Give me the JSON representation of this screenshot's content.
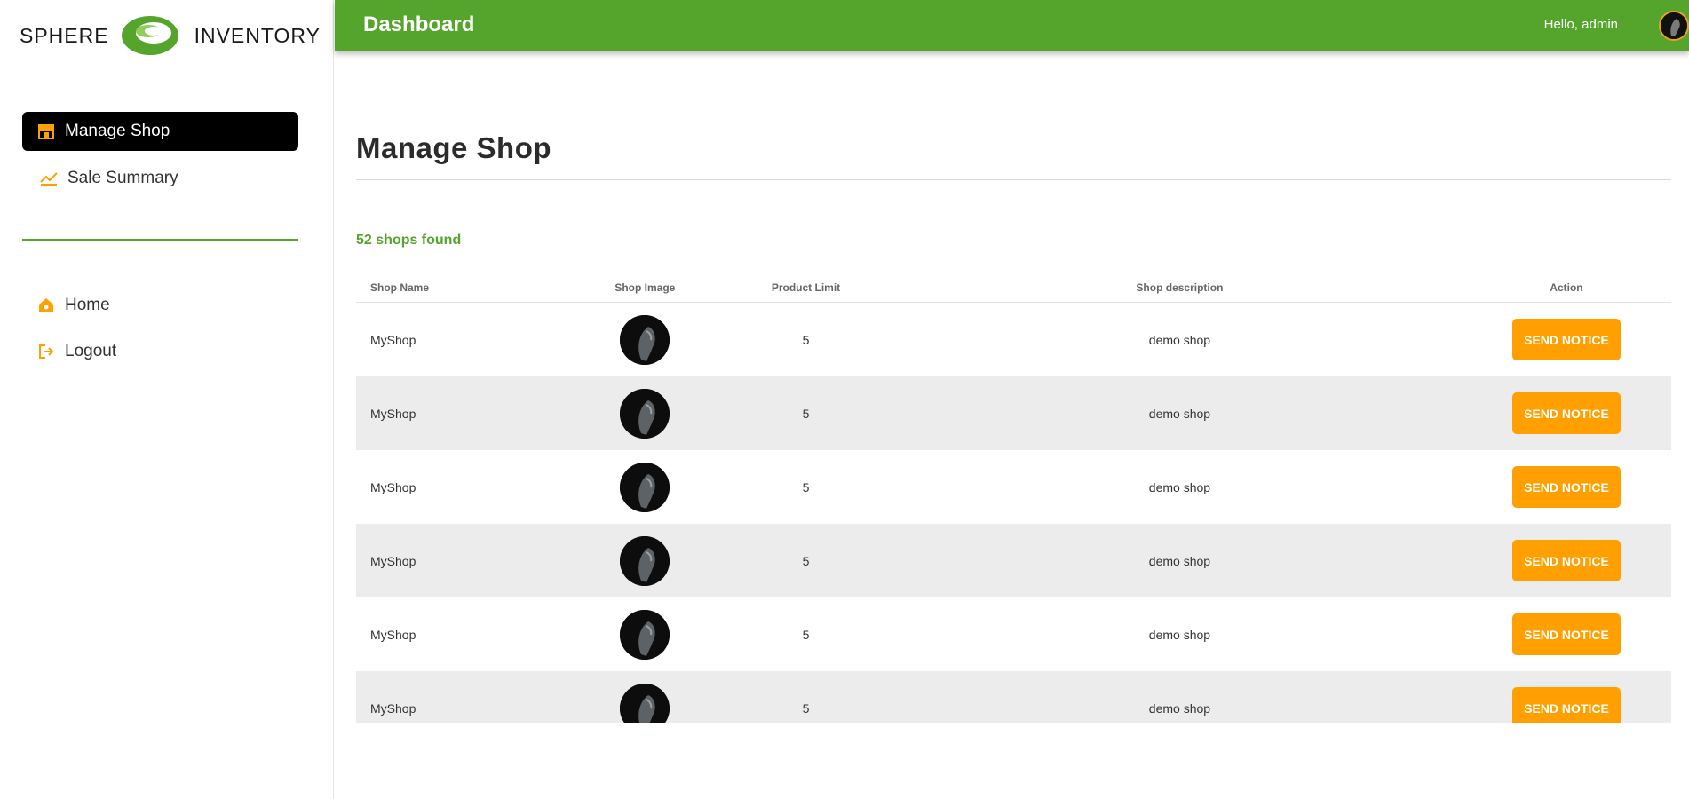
{
  "brand": {
    "left_word": "SPHERE",
    "right_word": "INVENTORY",
    "accent": "#55a52c",
    "orange": "#ffa000"
  },
  "sidebar": {
    "primary_items": [
      {
        "label": "Manage Shop",
        "icon": "shop-icon",
        "active": true
      },
      {
        "label": "Sale Summary",
        "icon": "chart-line-icon",
        "active": false
      }
    ],
    "secondary_items": [
      {
        "label": "Home",
        "icon": "home-icon"
      },
      {
        "label": "Logout",
        "icon": "logout-icon"
      }
    ]
  },
  "header": {
    "title": "Dashboard",
    "greeting": "Hello, admin"
  },
  "main": {
    "title": "Manage Shop",
    "count_text": "52 shops found",
    "table": {
      "columns": [
        "Shop Name",
        "Shop Image",
        "Product Limit",
        "Shop description",
        "Action"
      ],
      "rows": [
        {
          "name": "MyShop",
          "limit": "5",
          "description": "demo shop",
          "action": "SEND NOTICE"
        },
        {
          "name": "MyShop",
          "limit": "5",
          "description": "demo shop",
          "action": "SEND NOTICE"
        },
        {
          "name": "MyShop",
          "limit": "5",
          "description": "demo shop",
          "action": "SEND NOTICE"
        },
        {
          "name": "MyShop",
          "limit": "5",
          "description": "demo shop",
          "action": "SEND NOTICE"
        },
        {
          "name": "MyShop",
          "limit": "5",
          "description": "demo shop",
          "action": "SEND NOTICE"
        },
        {
          "name": "MyShop",
          "limit": "5",
          "description": "demo shop",
          "action": "SEND NOTICE"
        }
      ]
    }
  }
}
